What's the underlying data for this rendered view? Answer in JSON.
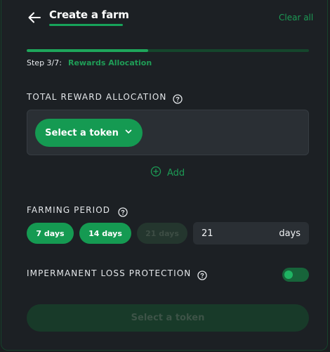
{
  "header": {
    "back_icon": "arrow-left-icon",
    "title": "Create a farm",
    "clear_all": "Clear all"
  },
  "progress": {
    "current_step": 3,
    "total_steps": 7,
    "fraction": 0.43,
    "step_label": "Step 3/7:",
    "step_name": "Rewards Allocation"
  },
  "reward_allocation": {
    "label": "TOTAL REWARD ALLOCATION",
    "help_icon": "question-circle-icon",
    "select_token_label": "Select a token",
    "select_token_icon": "chevron-down-icon",
    "add_icon": "plus-circle-icon",
    "add_label": "Add"
  },
  "farming_period": {
    "label": "FARMING PERIOD",
    "help_icon": "question-circle-icon",
    "options": [
      {
        "label": "7 days",
        "active": true
      },
      {
        "label": "14 days",
        "active": true
      },
      {
        "label": "21 days",
        "active": false
      }
    ],
    "custom_value": "21",
    "custom_unit": "days"
  },
  "il_protection": {
    "label": "IMPERMANENT LOSS PROTECTION",
    "help_icon": "question-circle-icon",
    "enabled": false
  },
  "submit": {
    "label": "Select a token"
  },
  "colors": {
    "accent": "#159a52",
    "accent_text": "#1d9a55",
    "background": "#1c2024",
    "field": "#2a2f34"
  }
}
